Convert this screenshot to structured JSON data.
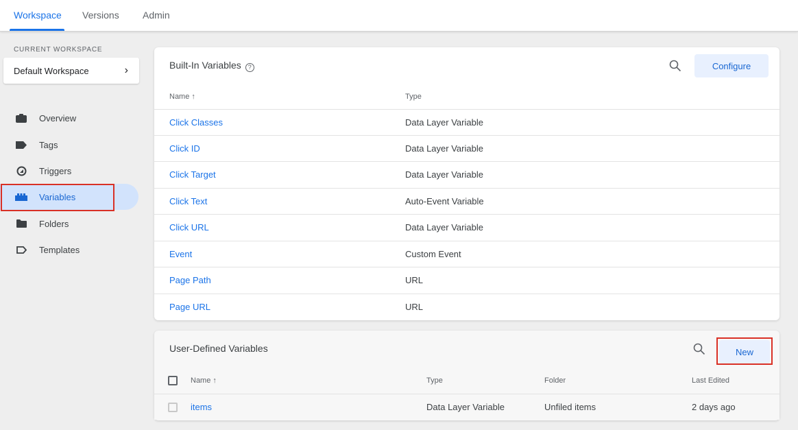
{
  "nav": {
    "tabs": [
      {
        "label": "Workspace"
      },
      {
        "label": "Versions"
      },
      {
        "label": "Admin"
      }
    ]
  },
  "workspace": {
    "section_label": "CURRENT WORKSPACE",
    "name": "Default Workspace",
    "chevron": "›"
  },
  "sidebar": {
    "items": [
      {
        "label": "Overview",
        "icon": "briefcase-icon"
      },
      {
        "label": "Tags",
        "icon": "tag-icon"
      },
      {
        "label": "Triggers",
        "icon": "trigger-icon"
      },
      {
        "label": "Variables",
        "icon": "blocks-icon",
        "active": true
      },
      {
        "label": "Folders",
        "icon": "folder-icon"
      },
      {
        "label": "Templates",
        "icon": "template-icon"
      }
    ]
  },
  "builtin": {
    "title": "Built-In Variables",
    "help": "?",
    "configure_label": "Configure",
    "headers": {
      "name": "Name ↑",
      "type": "Type"
    },
    "rows": [
      {
        "name": "Click Classes",
        "type": "Data Layer Variable"
      },
      {
        "name": "Click ID",
        "type": "Data Layer Variable"
      },
      {
        "name": "Click Target",
        "type": "Data Layer Variable"
      },
      {
        "name": "Click Text",
        "type": "Auto-Event Variable"
      },
      {
        "name": "Click URL",
        "type": "Data Layer Variable"
      },
      {
        "name": "Event",
        "type": "Custom Event"
      },
      {
        "name": "Page Path",
        "type": "URL"
      },
      {
        "name": "Page URL",
        "type": "URL"
      }
    ]
  },
  "userdefined": {
    "title": "User-Defined Variables",
    "new_label": "New",
    "headers": {
      "name": "Name ↑",
      "type": "Type",
      "folder": "Folder",
      "last_edited": "Last Edited"
    },
    "rows": [
      {
        "name": "items",
        "type": "Data Layer Variable",
        "folder": "Unfiled items",
        "last_edited": "2 days ago"
      }
    ]
  },
  "colors": {
    "accent": "#1a73e8",
    "highlight": "#d93025",
    "active_bg": "#d2e3fc"
  }
}
